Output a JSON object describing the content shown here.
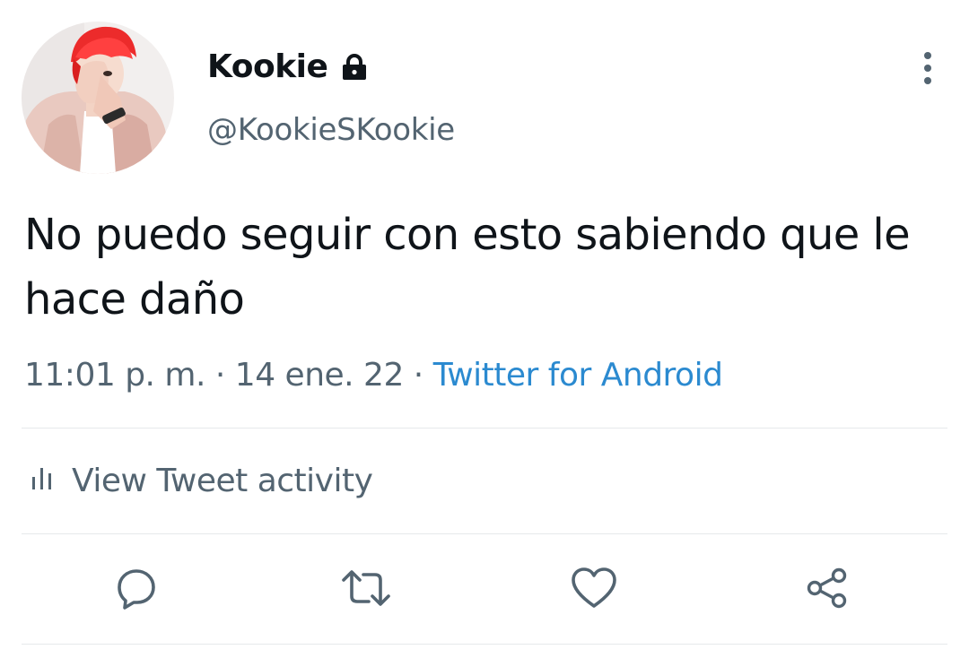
{
  "user": {
    "display_name": "Kookie",
    "handle": "@KookieSKookie",
    "protected_icon": "lock-icon",
    "avatar_icon": "avatar-photo"
  },
  "tweet": {
    "text": "No puedo seguir con esto sabiendo que le hace daño",
    "time": "11:01 p. m.",
    "separator1": " · ",
    "date": "14 ene. 22",
    "separator2": " · ",
    "source": "Twitter for Android"
  },
  "activity": {
    "label": "View Tweet activity",
    "icon": "bar-chart-icon"
  },
  "actions": {
    "reply_icon": "reply-icon",
    "retweet_icon": "retweet-icon",
    "like_icon": "heart-icon",
    "share_icon": "share-icon"
  },
  "colors": {
    "text": "#0f1419",
    "secondary": "#536471",
    "link": "#2b8ad0",
    "divider": "#e6e9eb"
  }
}
